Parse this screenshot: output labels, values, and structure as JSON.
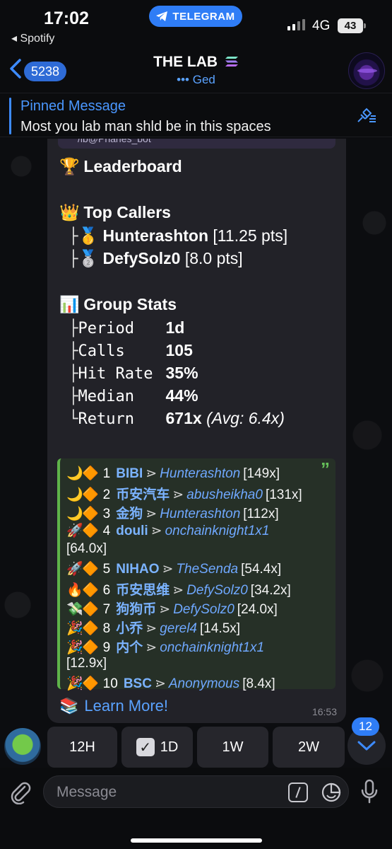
{
  "status_bar": {
    "time": "17:02",
    "back_app": "◂ Spotify",
    "telegram_pill": "TELEGRAM",
    "network": "4G",
    "battery": "43"
  },
  "header": {
    "back_count": "5238",
    "title": "THE LAB",
    "subtitle": "••• Ged"
  },
  "pinned": {
    "title": "Pinned Message",
    "text": "Most you lab man shld be in this spaces"
  },
  "message": {
    "cut_text": "/lb@Phanes_bot",
    "leaderboard_title": "Leaderboard",
    "top_callers_title": "Top Callers",
    "callers": [
      {
        "name": "Hunterashton",
        "pts": "[11.25 pts]"
      },
      {
        "name": "DefySolz0",
        "pts": "[8.0 pts]"
      }
    ],
    "group_stats_title": "Group Stats",
    "stats": [
      {
        "label": "Period",
        "value": "1d"
      },
      {
        "label": "Calls",
        "value": "105"
      },
      {
        "label": "Hit Rate",
        "value": "35%"
      },
      {
        "label": "Median",
        "value": "44%"
      },
      {
        "label": "Return",
        "value": "671x",
        "extra": "(Avg: 6.4x)"
      }
    ],
    "ranking": [
      {
        "icon": "🌙",
        "num": "1",
        "token": "BIBI",
        "user": "Hunterashton",
        "mult": "[149x]"
      },
      {
        "icon": "🌙",
        "num": "2",
        "token": "币安汽车",
        "user": "abusheikha0",
        "mult": "[131x]"
      },
      {
        "icon": "🌙",
        "num": "3",
        "token": "金狗",
        "user": "Hunterashton",
        "mult": "[112x]"
      },
      {
        "icon": "🚀",
        "num": "4",
        "token": "douli",
        "user": "onchainknight1x1",
        "mult": "[64.0x]"
      },
      {
        "icon": "🚀",
        "num": "5",
        "token": "NIHAO",
        "user": "TheSenda",
        "mult": "[54.4x]"
      },
      {
        "icon": "🔥",
        "num": "6",
        "token": "币安思维",
        "user": "DefySolz0",
        "mult": "[34.2x]"
      },
      {
        "icon": "💸",
        "num": "7",
        "token": "狗狗币",
        "user": "DefySolz0",
        "mult": "[24.0x]"
      },
      {
        "icon": "🎉",
        "num": "8",
        "token": "小乔",
        "user": "gerel4",
        "mult": "[14.5x]"
      },
      {
        "icon": "🎉",
        "num": "9",
        "token": "内个",
        "user": "onchainknight1x1",
        "mult": "[12.9x]"
      },
      {
        "icon": "🎉",
        "num": "10",
        "token": "BSC",
        "user": "Anonymous",
        "mult": "[8.4x]"
      }
    ],
    "learn_more": "Learn More!",
    "time": "16:53"
  },
  "keyboard": {
    "buttons": [
      "12H",
      "1D",
      "1W",
      "2W"
    ],
    "selected": "1D",
    "unread": "12"
  },
  "input": {
    "placeholder": "Message"
  },
  "colors": {
    "accent": "#2f7df6",
    "link": "#5aa2ff",
    "quote_bar": "#5fb34a"
  }
}
